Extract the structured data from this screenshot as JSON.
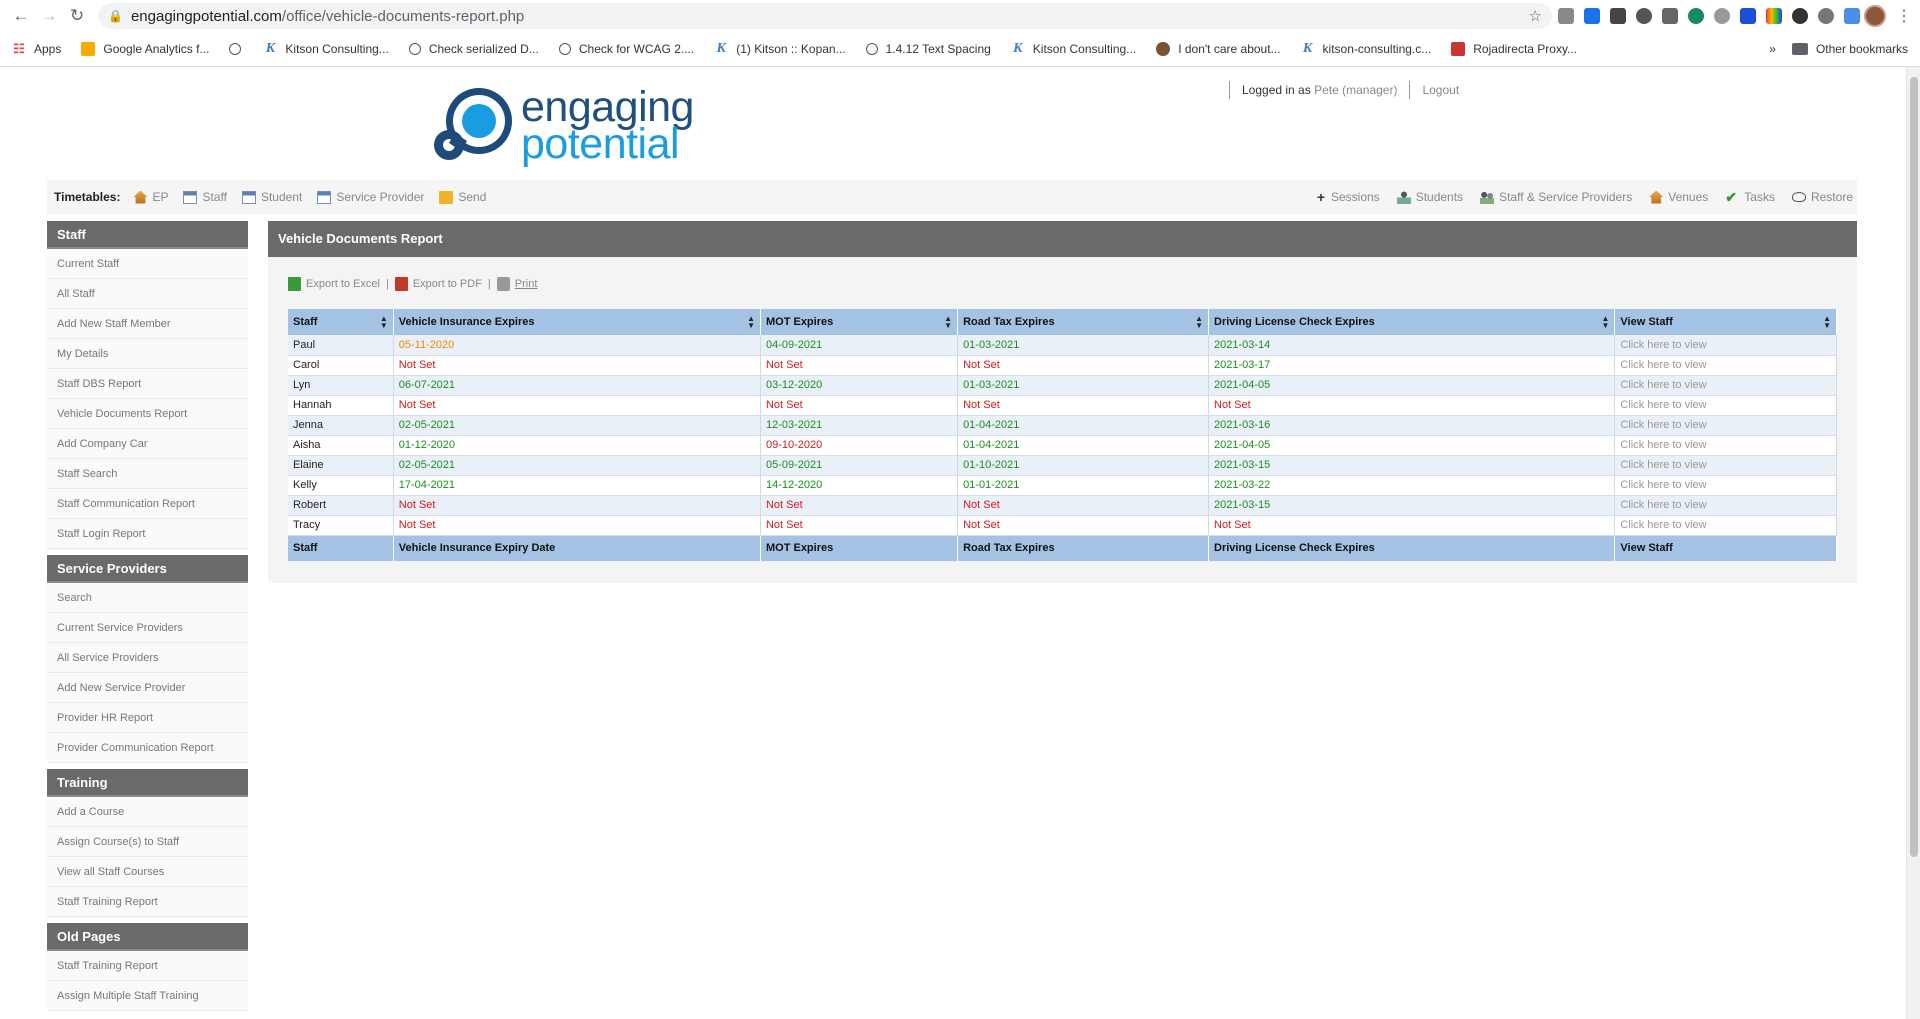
{
  "browser": {
    "url_host": "engagingpotential.com",
    "url_path": "/office/vehicle-documents-report.php",
    "bookmarks": [
      {
        "label": "Apps",
        "icon": "apps-grid-icon"
      },
      {
        "label": "Google Analytics f...",
        "icon": "google-analytics-icon"
      },
      {
        "label": "",
        "icon": "globe-icon"
      },
      {
        "label": "Kitson Consulting...",
        "icon": "kitson-k-icon"
      },
      {
        "label": "Check serialized D...",
        "icon": "globe-icon"
      },
      {
        "label": "Check for WCAG 2....",
        "icon": "globe-icon"
      },
      {
        "label": "(1) Kitson :: Kopan...",
        "icon": "kitson-k-icon"
      },
      {
        "label": "1.4.12 Text Spacing",
        "icon": "globe-icon"
      },
      {
        "label": "Kitson Consulting...",
        "icon": "kitson-k-icon"
      },
      {
        "label": "I don't care about...",
        "icon": "cookie-icon"
      },
      {
        "label": "kitson-consulting.c...",
        "icon": "kitson-k-icon"
      },
      {
        "label": "Rojadirecta Proxy...",
        "icon": "rojadirecta-icon"
      }
    ],
    "overflow": "»",
    "other_bookmarks": "Other bookmarks"
  },
  "header": {
    "logo_line1": "engaging",
    "logo_line2": "potential",
    "logged_in_prefix": "Logged in as",
    "user": "Pete (manager)",
    "logout": "Logout"
  },
  "menubar": {
    "timetables_label": "Timetables:",
    "left": [
      {
        "label": "EP",
        "icon": "house-icon"
      },
      {
        "label": "Staff",
        "icon": "calendar-icon"
      },
      {
        "label": "Student",
        "icon": "calendar-icon"
      },
      {
        "label": "Service Provider",
        "icon": "calendar-icon"
      },
      {
        "label": "Send",
        "icon": "envelope-icon"
      }
    ],
    "right": [
      {
        "label": "Sessions",
        "icon": "plus-icon"
      },
      {
        "label": "Students",
        "icon": "person-icon"
      },
      {
        "label": "Staff & Service Providers",
        "icon": "people-icon"
      },
      {
        "label": "Venues",
        "icon": "house-icon"
      },
      {
        "label": "Tasks",
        "icon": "checkmark-icon"
      },
      {
        "label": "Restore",
        "icon": "cloud-icon"
      }
    ]
  },
  "sidebar": {
    "groups": [
      {
        "title": "Staff",
        "items": [
          "Current Staff",
          "All Staff",
          "Add New Staff Member",
          "My Details",
          "Staff DBS Report",
          "Vehicle Documents Report",
          "Add Company Car",
          "Staff Search",
          "Staff Communication Report",
          "Staff Login Report"
        ]
      },
      {
        "title": "Service Providers",
        "items": [
          "Search",
          "Current Service Providers",
          "All Service Providers",
          "Add New Service Provider",
          "Provider HR Report",
          "Provider Communication Report"
        ]
      },
      {
        "title": "Training",
        "items": [
          "Add a Course",
          "Assign Course(s) to Staff",
          "View all Staff Courses",
          "Staff Training Report"
        ]
      },
      {
        "title": "Old Pages",
        "items": [
          "Staff Training Report",
          "Assign Multiple Staff Training"
        ]
      }
    ]
  },
  "main": {
    "title": "Vehicle Documents Report",
    "toolbar": {
      "excel": "Export to Excel",
      "pdf": "Export to PDF",
      "print": "Print",
      "separator": "|"
    },
    "table": {
      "headers": [
        "Staff",
        "Vehicle Insurance Expires",
        "MOT Expires",
        "Road Tax Expires",
        "Driving License Check Expires",
        "View Staff"
      ],
      "footers": [
        "Staff",
        "Vehicle Insurance Expiry Date",
        "MOT Expires",
        "Road Tax Expires",
        "Driving License Check Expires",
        "View Staff"
      ],
      "status_colors": {
        "ok": "#1a8f1a",
        "expired": "#d11b1b",
        "expiring": "#f08a00"
      },
      "rows": [
        {
          "staff": "Paul",
          "insurance": {
            "v": "05-11-2020",
            "s": "warn"
          },
          "mot": {
            "v": "04-09-2021",
            "s": "ok"
          },
          "tax": {
            "v": "01-03-2021",
            "s": "ok"
          },
          "license": {
            "v": "2021-03-14",
            "s": "ok"
          },
          "view": "Click here to view"
        },
        {
          "staff": "Carol",
          "insurance": {
            "v": "Not Set",
            "s": "bad"
          },
          "mot": {
            "v": "Not Set",
            "s": "bad"
          },
          "tax": {
            "v": "Not Set",
            "s": "bad"
          },
          "license": {
            "v": "2021-03-17",
            "s": "ok"
          },
          "view": "Click here to view"
        },
        {
          "staff": "Lyn",
          "insurance": {
            "v": "06-07-2021",
            "s": "ok"
          },
          "mot": {
            "v": "03-12-2020",
            "s": "ok"
          },
          "tax": {
            "v": "01-03-2021",
            "s": "ok"
          },
          "license": {
            "v": "2021-04-05",
            "s": "ok"
          },
          "view": "Click here to view"
        },
        {
          "staff": "Hannah",
          "insurance": {
            "v": "Not Set",
            "s": "bad"
          },
          "mot": {
            "v": "Not Set",
            "s": "bad"
          },
          "tax": {
            "v": "Not Set",
            "s": "bad"
          },
          "license": {
            "v": "Not Set",
            "s": "bad"
          },
          "view": "Click here to view"
        },
        {
          "staff": "Jenna",
          "insurance": {
            "v": "02-05-2021",
            "s": "ok"
          },
          "mot": {
            "v": "12-03-2021",
            "s": "ok"
          },
          "tax": {
            "v": "01-04-2021",
            "s": "ok"
          },
          "license": {
            "v": "2021-03-16",
            "s": "ok"
          },
          "view": "Click here to view"
        },
        {
          "staff": "Aisha",
          "insurance": {
            "v": "01-12-2020",
            "s": "ok"
          },
          "mot": {
            "v": "09-10-2020",
            "s": "bad"
          },
          "tax": {
            "v": "01-04-2021",
            "s": "ok"
          },
          "license": {
            "v": "2021-04-05",
            "s": "ok"
          },
          "view": "Click here to view"
        },
        {
          "staff": "Elaine",
          "insurance": {
            "v": "02-05-2021",
            "s": "ok"
          },
          "mot": {
            "v": "05-09-2021",
            "s": "ok"
          },
          "tax": {
            "v": "01-10-2021",
            "s": "ok"
          },
          "license": {
            "v": "2021-03-15",
            "s": "ok"
          },
          "view": "Click here to view"
        },
        {
          "staff": "Kelly",
          "insurance": {
            "v": "17-04-2021",
            "s": "ok"
          },
          "mot": {
            "v": "14-12-2020",
            "s": "ok"
          },
          "tax": {
            "v": "01-01-2021",
            "s": "ok"
          },
          "license": {
            "v": "2021-03-22",
            "s": "ok"
          },
          "view": "Click here to view"
        },
        {
          "staff": "Robert",
          "insurance": {
            "v": "Not Set",
            "s": "bad"
          },
          "mot": {
            "v": "Not Set",
            "s": "bad"
          },
          "tax": {
            "v": "Not Set",
            "s": "bad"
          },
          "license": {
            "v": "2021-03-15",
            "s": "ok"
          },
          "view": "Click here to view"
        },
        {
          "staff": "Tracy",
          "insurance": {
            "v": "Not Set",
            "s": "bad"
          },
          "mot": {
            "v": "Not Set",
            "s": "bad"
          },
          "tax": {
            "v": "Not Set",
            "s": "bad"
          },
          "license": {
            "v": "Not Set",
            "s": "bad"
          },
          "view": "Click here to view"
        }
      ]
    }
  }
}
